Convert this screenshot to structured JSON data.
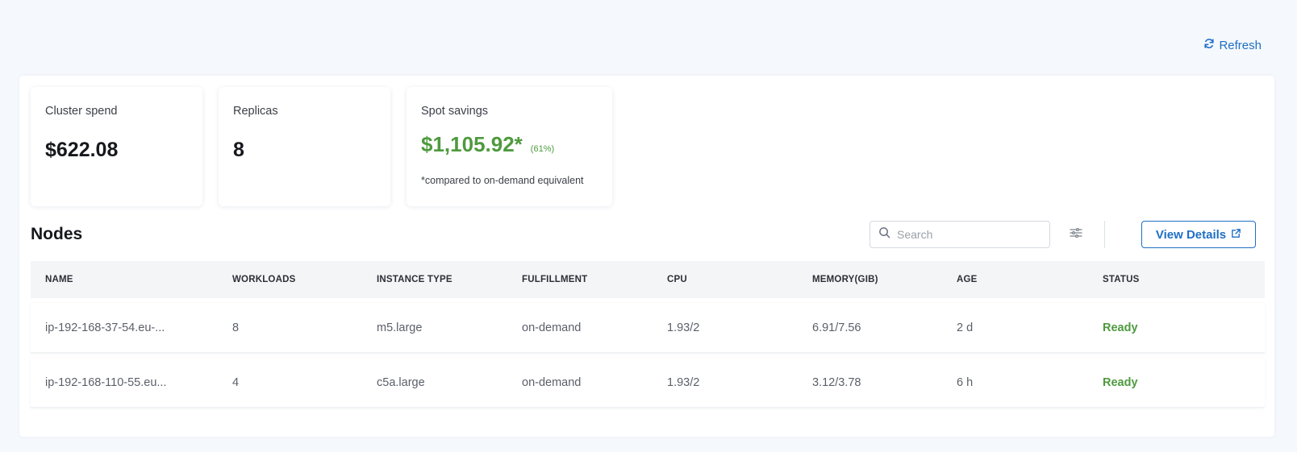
{
  "header": {
    "refresh_label": "Refresh"
  },
  "cards": {
    "cluster_spend": {
      "title": "Cluster spend",
      "value": "$622.08"
    },
    "replicas": {
      "title": "Replicas",
      "value": "8"
    },
    "spot_savings": {
      "title": "Spot savings",
      "value": "$1,105.92*",
      "percent": "(61%)",
      "note": "*compared to on-demand equivalent"
    }
  },
  "nodes": {
    "title": "Nodes",
    "search_placeholder": "Search",
    "view_details_label": "View Details",
    "columns": [
      "NAME",
      "WORKLOADS",
      "INSTANCE TYPE",
      "FULFILLMENT",
      "CPU",
      "MEMORY(GIB)",
      "AGE",
      "STATUS"
    ],
    "rows": [
      {
        "name": "ip-192-168-37-54.eu-...",
        "workloads": "8",
        "instance_type": "m5.large",
        "fulfillment": "on-demand",
        "cpu": "1.93/2",
        "memory": "6.91/7.56",
        "age": "2 d",
        "status": "Ready"
      },
      {
        "name": "ip-192-168-110-55.eu...",
        "workloads": "4",
        "instance_type": "c5a.large",
        "fulfillment": "on-demand",
        "cpu": "1.93/2",
        "memory": "3.12/3.78",
        "age": "6 h",
        "status": "Ready"
      }
    ]
  },
  "colors": {
    "accent": "#1f6fc5",
    "success": "#4e9a3e"
  },
  "icons": {
    "refresh": "refresh-icon",
    "search": "search-icon",
    "filter": "filter-sliders-icon",
    "external_link": "external-link-icon"
  }
}
